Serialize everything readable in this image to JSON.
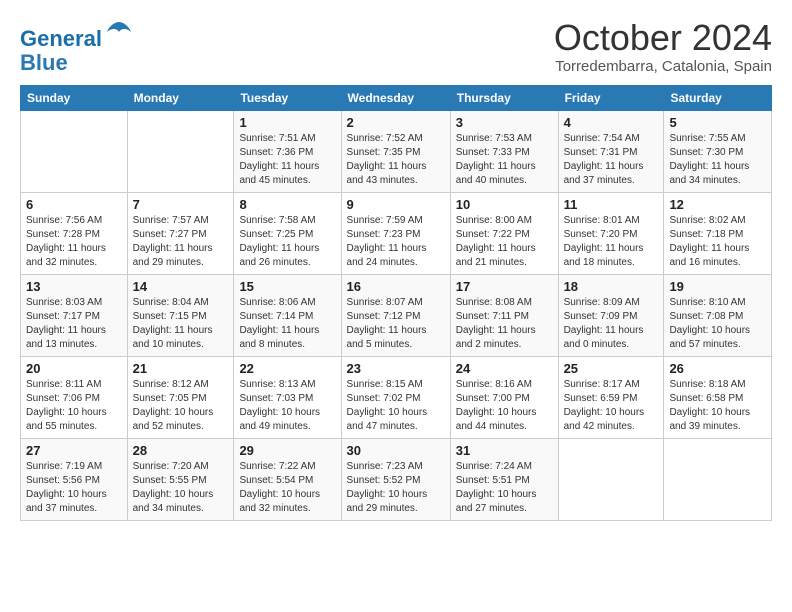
{
  "header": {
    "logo_line1": "General",
    "logo_line2": "Blue",
    "month_title": "October 2024",
    "location": "Torredembarra, Catalonia, Spain"
  },
  "days_of_week": [
    "Sunday",
    "Monday",
    "Tuesday",
    "Wednesday",
    "Thursday",
    "Friday",
    "Saturday"
  ],
  "weeks": [
    [
      {
        "day": "",
        "detail": ""
      },
      {
        "day": "",
        "detail": ""
      },
      {
        "day": "1",
        "detail": "Sunrise: 7:51 AM\nSunset: 7:36 PM\nDaylight: 11 hours\nand 45 minutes."
      },
      {
        "day": "2",
        "detail": "Sunrise: 7:52 AM\nSunset: 7:35 PM\nDaylight: 11 hours\nand 43 minutes."
      },
      {
        "day": "3",
        "detail": "Sunrise: 7:53 AM\nSunset: 7:33 PM\nDaylight: 11 hours\nand 40 minutes."
      },
      {
        "day": "4",
        "detail": "Sunrise: 7:54 AM\nSunset: 7:31 PM\nDaylight: 11 hours\nand 37 minutes."
      },
      {
        "day": "5",
        "detail": "Sunrise: 7:55 AM\nSunset: 7:30 PM\nDaylight: 11 hours\nand 34 minutes."
      }
    ],
    [
      {
        "day": "6",
        "detail": "Sunrise: 7:56 AM\nSunset: 7:28 PM\nDaylight: 11 hours\nand 32 minutes."
      },
      {
        "day": "7",
        "detail": "Sunrise: 7:57 AM\nSunset: 7:27 PM\nDaylight: 11 hours\nand 29 minutes."
      },
      {
        "day": "8",
        "detail": "Sunrise: 7:58 AM\nSunset: 7:25 PM\nDaylight: 11 hours\nand 26 minutes."
      },
      {
        "day": "9",
        "detail": "Sunrise: 7:59 AM\nSunset: 7:23 PM\nDaylight: 11 hours\nand 24 minutes."
      },
      {
        "day": "10",
        "detail": "Sunrise: 8:00 AM\nSunset: 7:22 PM\nDaylight: 11 hours\nand 21 minutes."
      },
      {
        "day": "11",
        "detail": "Sunrise: 8:01 AM\nSunset: 7:20 PM\nDaylight: 11 hours\nand 18 minutes."
      },
      {
        "day": "12",
        "detail": "Sunrise: 8:02 AM\nSunset: 7:18 PM\nDaylight: 11 hours\nand 16 minutes."
      }
    ],
    [
      {
        "day": "13",
        "detail": "Sunrise: 8:03 AM\nSunset: 7:17 PM\nDaylight: 11 hours\nand 13 minutes."
      },
      {
        "day": "14",
        "detail": "Sunrise: 8:04 AM\nSunset: 7:15 PM\nDaylight: 11 hours\nand 10 minutes."
      },
      {
        "day": "15",
        "detail": "Sunrise: 8:06 AM\nSunset: 7:14 PM\nDaylight: 11 hours\nand 8 minutes."
      },
      {
        "day": "16",
        "detail": "Sunrise: 8:07 AM\nSunset: 7:12 PM\nDaylight: 11 hours\nand 5 minutes."
      },
      {
        "day": "17",
        "detail": "Sunrise: 8:08 AM\nSunset: 7:11 PM\nDaylight: 11 hours\nand 2 minutes."
      },
      {
        "day": "18",
        "detail": "Sunrise: 8:09 AM\nSunset: 7:09 PM\nDaylight: 11 hours\nand 0 minutes."
      },
      {
        "day": "19",
        "detail": "Sunrise: 8:10 AM\nSunset: 7:08 PM\nDaylight: 10 hours\nand 57 minutes."
      }
    ],
    [
      {
        "day": "20",
        "detail": "Sunrise: 8:11 AM\nSunset: 7:06 PM\nDaylight: 10 hours\nand 55 minutes."
      },
      {
        "day": "21",
        "detail": "Sunrise: 8:12 AM\nSunset: 7:05 PM\nDaylight: 10 hours\nand 52 minutes."
      },
      {
        "day": "22",
        "detail": "Sunrise: 8:13 AM\nSunset: 7:03 PM\nDaylight: 10 hours\nand 49 minutes."
      },
      {
        "day": "23",
        "detail": "Sunrise: 8:15 AM\nSunset: 7:02 PM\nDaylight: 10 hours\nand 47 minutes."
      },
      {
        "day": "24",
        "detail": "Sunrise: 8:16 AM\nSunset: 7:00 PM\nDaylight: 10 hours\nand 44 minutes."
      },
      {
        "day": "25",
        "detail": "Sunrise: 8:17 AM\nSunset: 6:59 PM\nDaylight: 10 hours\nand 42 minutes."
      },
      {
        "day": "26",
        "detail": "Sunrise: 8:18 AM\nSunset: 6:58 PM\nDaylight: 10 hours\nand 39 minutes."
      }
    ],
    [
      {
        "day": "27",
        "detail": "Sunrise: 7:19 AM\nSunset: 5:56 PM\nDaylight: 10 hours\nand 37 minutes."
      },
      {
        "day": "28",
        "detail": "Sunrise: 7:20 AM\nSunset: 5:55 PM\nDaylight: 10 hours\nand 34 minutes."
      },
      {
        "day": "29",
        "detail": "Sunrise: 7:22 AM\nSunset: 5:54 PM\nDaylight: 10 hours\nand 32 minutes."
      },
      {
        "day": "30",
        "detail": "Sunrise: 7:23 AM\nSunset: 5:52 PM\nDaylight: 10 hours\nand 29 minutes."
      },
      {
        "day": "31",
        "detail": "Sunrise: 7:24 AM\nSunset: 5:51 PM\nDaylight: 10 hours\nand 27 minutes."
      },
      {
        "day": "",
        "detail": ""
      },
      {
        "day": "",
        "detail": ""
      }
    ]
  ]
}
